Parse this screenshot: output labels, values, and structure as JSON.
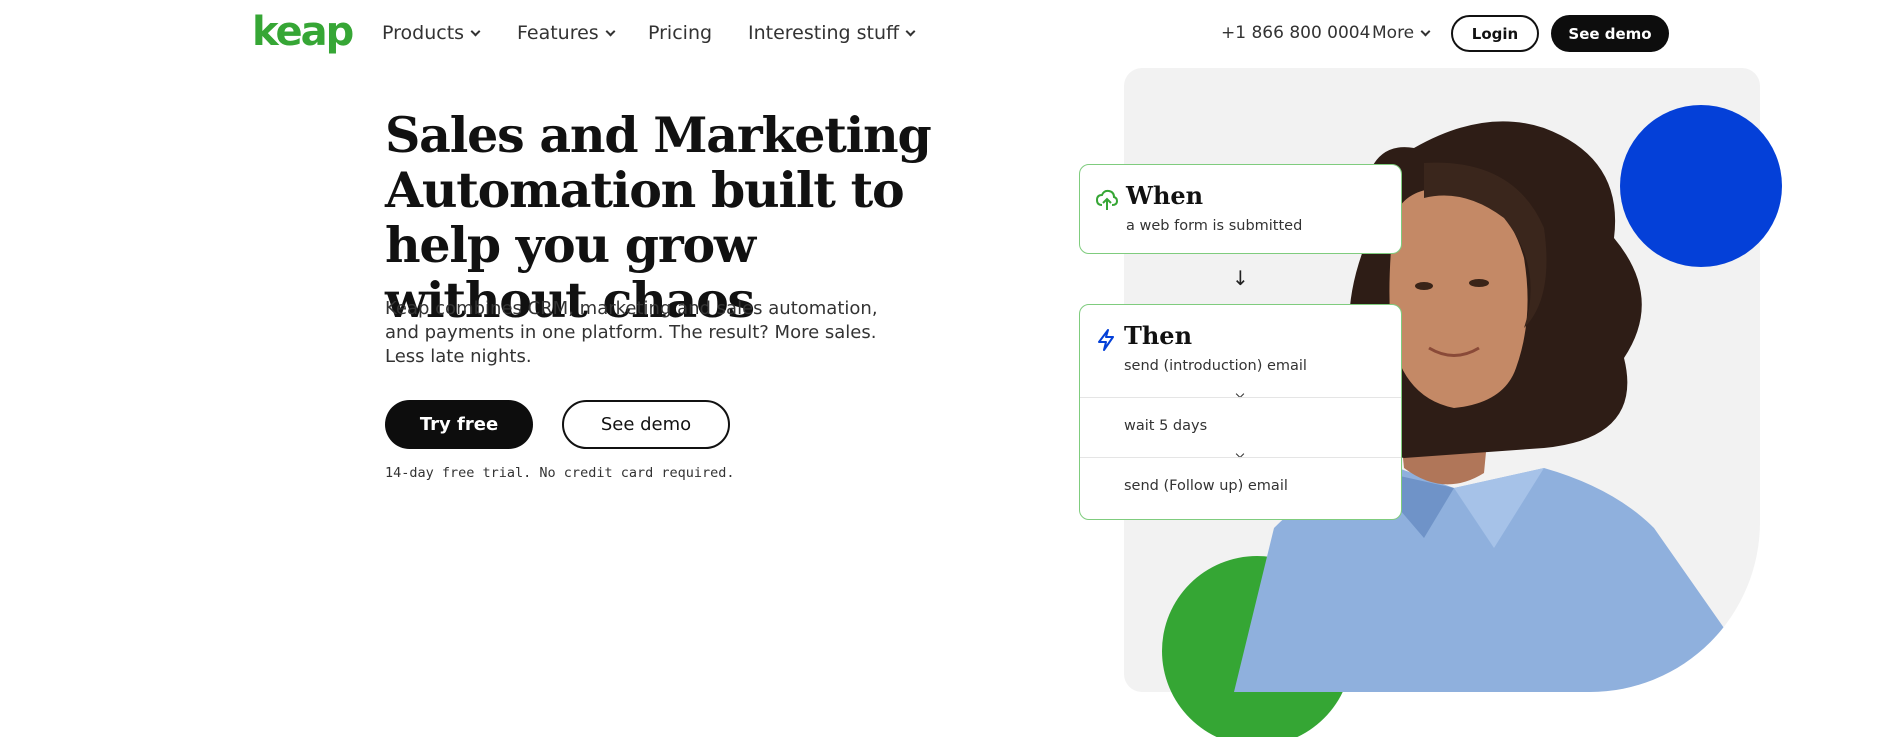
{
  "brand": {
    "logo_text": "keap",
    "accent": "#36a635",
    "blue": "#0440d8"
  },
  "nav": {
    "items": [
      {
        "label": "Products",
        "dropdown": true
      },
      {
        "label": "Features",
        "dropdown": true
      },
      {
        "label": "Pricing",
        "dropdown": false
      },
      {
        "label": "Interesting stuff",
        "dropdown": true
      }
    ],
    "phone": "+1 866 800 0004",
    "more_label": "More",
    "login_label": "Login",
    "see_demo_label": "See demo"
  },
  "hero": {
    "title": "Sales and Marketing Automation built to help you grow without chaos",
    "subtitle": "Keap combines CRM, marketing and sales automation, and payments in one platform. The result? More sales. Less late nights.",
    "try_free_label": "Try free",
    "see_demo_label": "See demo",
    "trial_note": "14-day free trial. No credit card required."
  },
  "workflow": {
    "when": {
      "heading": "When",
      "text": "a web form is submitted",
      "icon": "cloud-upload-icon"
    },
    "then": {
      "heading": "Then",
      "icon": "lightning-icon",
      "steps": [
        "send (introduction) email",
        "wait 5 days",
        "send (Follow up) email"
      ]
    }
  }
}
